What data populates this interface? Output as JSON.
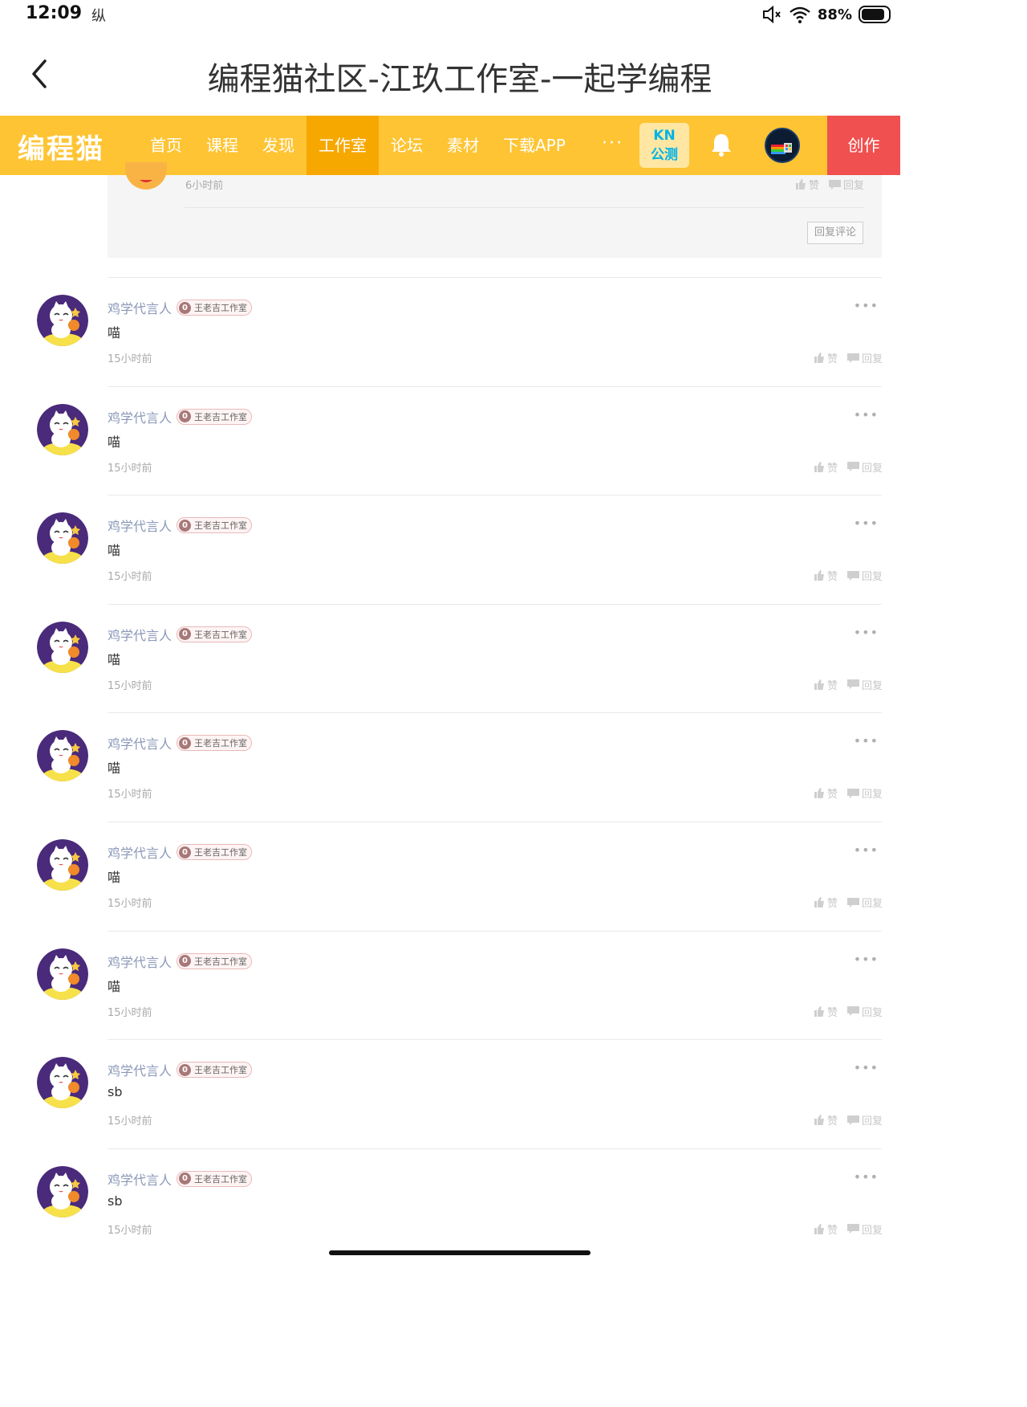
{
  "status": {
    "time": "12:09",
    "notif_glyph": "纵",
    "battery": "88%",
    "battery_level": 0.88
  },
  "appbar": {
    "title": "编程猫社区-江玖工作室-一起学编程"
  },
  "nav": {
    "logo": "编程猫",
    "items": [
      "首页",
      "课程",
      "发现",
      "工作室",
      "论坛",
      "素材",
      "下载APP"
    ],
    "active": "工作室",
    "more": "···",
    "kn_top": "KN",
    "kn_bottom": "公测",
    "create": "创作"
  },
  "reply_box": {
    "time": "6小时前",
    "like": "赞",
    "reply": "回复",
    "reply_comment_btn": "回复评论"
  },
  "comments": [
    {
      "name": "鸡学代言人",
      "level": "0",
      "tag": "王老吉工作室",
      "text": "喵",
      "time": "15小时前",
      "like": "赞",
      "reply": "回复"
    },
    {
      "name": "鸡学代言人",
      "level": "0",
      "tag": "王老吉工作室",
      "text": "喵",
      "time": "15小时前",
      "like": "赞",
      "reply": "回复"
    },
    {
      "name": "鸡学代言人",
      "level": "0",
      "tag": "王老吉工作室",
      "text": "喵",
      "time": "15小时前",
      "like": "赞",
      "reply": "回复"
    },
    {
      "name": "鸡学代言人",
      "level": "0",
      "tag": "王老吉工作室",
      "text": "喵",
      "time": "15小时前",
      "like": "赞",
      "reply": "回复"
    },
    {
      "name": "鸡学代言人",
      "level": "0",
      "tag": "王老吉工作室",
      "text": "喵",
      "time": "15小时前",
      "like": "赞",
      "reply": "回复"
    },
    {
      "name": "鸡学代言人",
      "level": "0",
      "tag": "王老吉工作室",
      "text": "喵",
      "time": "15小时前",
      "like": "赞",
      "reply": "回复"
    },
    {
      "name": "鸡学代言人",
      "level": "0",
      "tag": "王老吉工作室",
      "text": "喵",
      "time": "15小时前",
      "like": "赞",
      "reply": "回复"
    },
    {
      "name": "鸡学代言人",
      "level": "0",
      "tag": "王老吉工作室",
      "text": "sb",
      "time": "15小时前",
      "like": "赞",
      "reply": "回复"
    },
    {
      "name": "鸡学代言人",
      "level": "0",
      "tag": "王老吉工作室",
      "text": "sb",
      "time": "15小时前",
      "like": "赞",
      "reply": "回复"
    }
  ],
  "more_glyph": "•••",
  "colors": {
    "nav_bg": "#fec433",
    "nav_active": "#f6a800",
    "create_bg": "#f0504f",
    "name": "#8a98b8",
    "avatar_bg": "#4a2a7a"
  }
}
